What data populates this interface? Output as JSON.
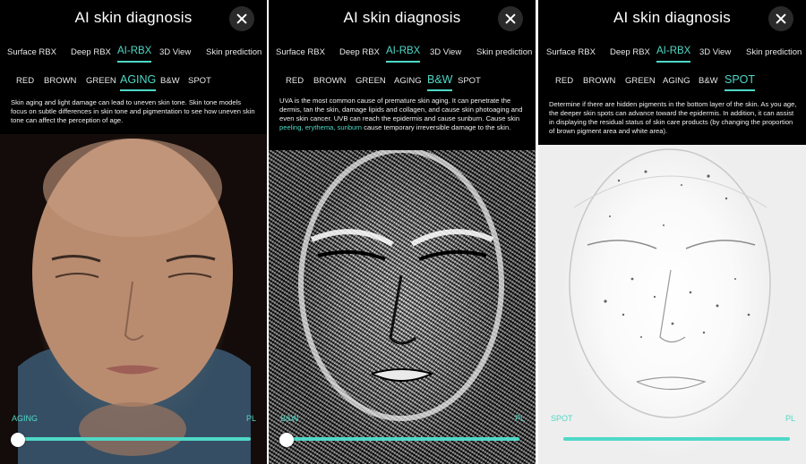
{
  "app": {
    "title": "AI skin diagnosis"
  },
  "tabs": [
    "Surface RBX",
    "Deep RBX",
    "AI-RBX",
    "3D View",
    "Skin prediction"
  ],
  "subtabs": [
    "RED",
    "BROWN",
    "GREEN",
    "AGING",
    "B&W",
    "SPOT"
  ],
  "panels": [
    {
      "active_tab": "AI-RBX",
      "active_subtab": "AGING",
      "description": "Skin aging and light damage can lead to uneven skin tone. Skin tone models focus on subtle differences in skin tone and pigmentation to see how uneven skin tone can affect the perception of age.",
      "slider": {
        "left_label": "AGING",
        "right_label": "PL",
        "value": 0.0
      }
    },
    {
      "active_tab": "AI-RBX",
      "active_subtab": "B&W",
      "description_pre": "UVA is the most common cause of premature skin aging. It can penetrate the dermis, tan the skin, damage lipids and collagen, and cause skin photoaging and even skin cancer. UVB can reach the epidermis and cause sunburn. Cause skin ",
      "description_highlight": "peeling, erythema, sunburn",
      "description_post": " cause temporary irreversible damage to the skin.",
      "slider": {
        "left_label": "B&W",
        "right_label": "PL",
        "value": 0.0
      }
    },
    {
      "active_tab": "AI-RBX",
      "active_subtab": "SPOT",
      "description": "Determine if there are hidden pigments in the bottom layer of the skin. As you age, the deeper skin spots can advance toward the epidermis. In addition, it can assist in displaying the residual status of skin care products (by changing the proportion of brown pigment area and white area).",
      "slider": {
        "left_label": "SPOT",
        "right_label": "PL",
        "value": 1.0
      }
    }
  ],
  "colors": {
    "accent": "#4fd8c6",
    "background": "#000000",
    "text": "#ffffff"
  },
  "icons": {
    "close": "close-icon"
  }
}
